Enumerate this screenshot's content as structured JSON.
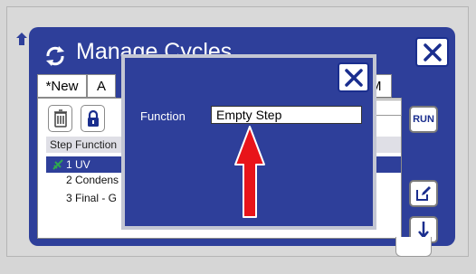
{
  "window": {
    "title": "Manage Cycles"
  },
  "tabs": [
    {
      "label": "*New"
    },
    {
      "label": "A"
    },
    {
      "label": "M"
    }
  ],
  "toolbar": {
    "run_label": "RUN"
  },
  "list": {
    "header": "Step Function",
    "rows": [
      {
        "text": "1 UV",
        "selected": true
      },
      {
        "text": "2 Condens"
      },
      {
        "text": "3 Final - G"
      }
    ]
  },
  "step_dialog": {
    "function_label": "Function",
    "function_value": "Empty Step"
  },
  "colors": {
    "dialog_blue": "#2e3f9a",
    "arrow_red": "#e8141a",
    "wire_green": "#2fa84f"
  },
  "icons": [
    "refresh-icon",
    "close-icon",
    "trash-icon",
    "lock-icon",
    "edit-icon",
    "arrow-down-icon",
    "red-arrow-icon"
  ]
}
